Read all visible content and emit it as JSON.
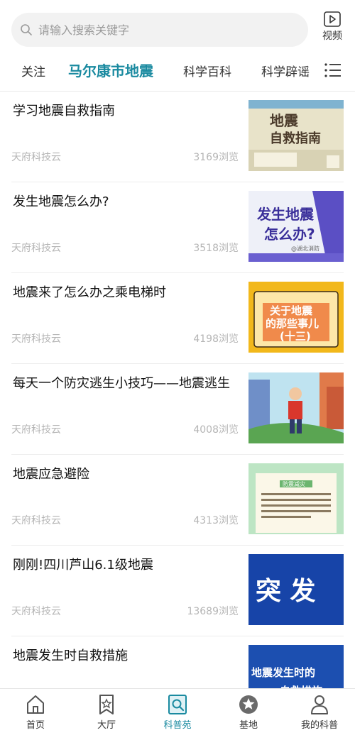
{
  "search": {
    "placeholder": "请输入搜索关键字"
  },
  "video": {
    "label": "视频"
  },
  "tabs": [
    {
      "label": "关注"
    },
    {
      "label": "马尔康市地震"
    },
    {
      "label": "科学百科"
    },
    {
      "label": "科学辟谣"
    }
  ],
  "articles": [
    {
      "title": "学习地震自救指南",
      "source": "天府科技云",
      "views": "3169浏览",
      "thumb_text": [
        "地震",
        "自救指南"
      ]
    },
    {
      "title": "发生地震怎么办?",
      "source": "天府科技云",
      "views": "3518浏览",
      "thumb_text": [
        "发生地震",
        "怎么办?",
        "@湖北消防"
      ]
    },
    {
      "title": "地震来了怎么办之乘电梯时",
      "source": "天府科技云",
      "views": "4198浏览",
      "thumb_text": [
        "关于地震",
        "的那些事儿",
        "(十三)"
      ]
    },
    {
      "title": "每天一个防灾逃生小技巧——地震逃生",
      "source": "天府科技云",
      "views": "4008浏览",
      "thumb_text": []
    },
    {
      "title": "地震应急避险",
      "source": "天府科技云",
      "views": "4313浏览",
      "thumb_text": [
        "防震减灾"
      ]
    },
    {
      "title": "刚刚!四川芦山6.1级地震",
      "source": "天府科技云",
      "views": "13689浏览",
      "thumb_text": [
        "突 发"
      ]
    },
    {
      "title": "地震发生时自救措施",
      "source": "",
      "views": "",
      "thumb_text": [
        "地震发生时的",
        "自救措施"
      ]
    }
  ],
  "nav": [
    {
      "label": "首页",
      "icon": "home-icon"
    },
    {
      "label": "大厅",
      "icon": "bookmark-star-icon"
    },
    {
      "label": "科普苑",
      "icon": "book-search-icon",
      "active": true
    },
    {
      "label": "基地",
      "icon": "star-circle-icon"
    },
    {
      "label": "我的科普",
      "icon": "user-icon"
    }
  ],
  "colors": {
    "accent": "#1a8aa0",
    "muted": "#b5b5b5"
  }
}
